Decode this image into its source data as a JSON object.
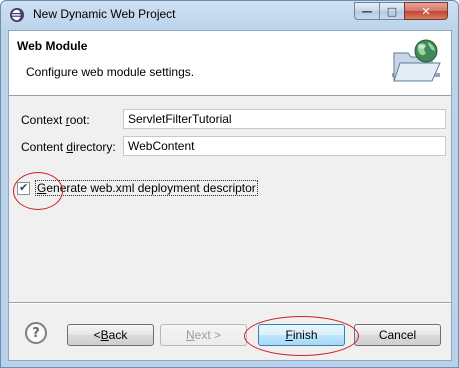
{
  "window": {
    "title": "New Dynamic Web Project",
    "minimize_glyph": "—",
    "maximize_glyph": "□",
    "close_glyph": "✕"
  },
  "banner": {
    "title": "Web Module",
    "description": "Configure web module settings.",
    "icon": "folder-globe-icon"
  },
  "form": {
    "context_root": {
      "label_pre": "Context ",
      "label_mnemonic": "r",
      "label_post": "oot:",
      "value": "ServletFilterTutorial"
    },
    "content_directory": {
      "label_pre": "Content ",
      "label_mnemonic": "d",
      "label_post": "irectory:",
      "value": "WebContent"
    },
    "generate_descriptor": {
      "label_mnemonic": "G",
      "label_post": "enerate web.xml deployment descriptor",
      "checked": true,
      "check_glyph": "✔"
    }
  },
  "buttons": {
    "help_glyph": "?",
    "back": {
      "pre": "< ",
      "mnemonic": "B",
      "post": "ack"
    },
    "next": {
      "mnemonic": "N",
      "post": "ext >"
    },
    "finish": {
      "mnemonic": "F",
      "post": "inish"
    },
    "cancel": "Cancel"
  },
  "colors": {
    "annotation_red": "#c8202a",
    "default_button_border": "#3c7fb1"
  }
}
